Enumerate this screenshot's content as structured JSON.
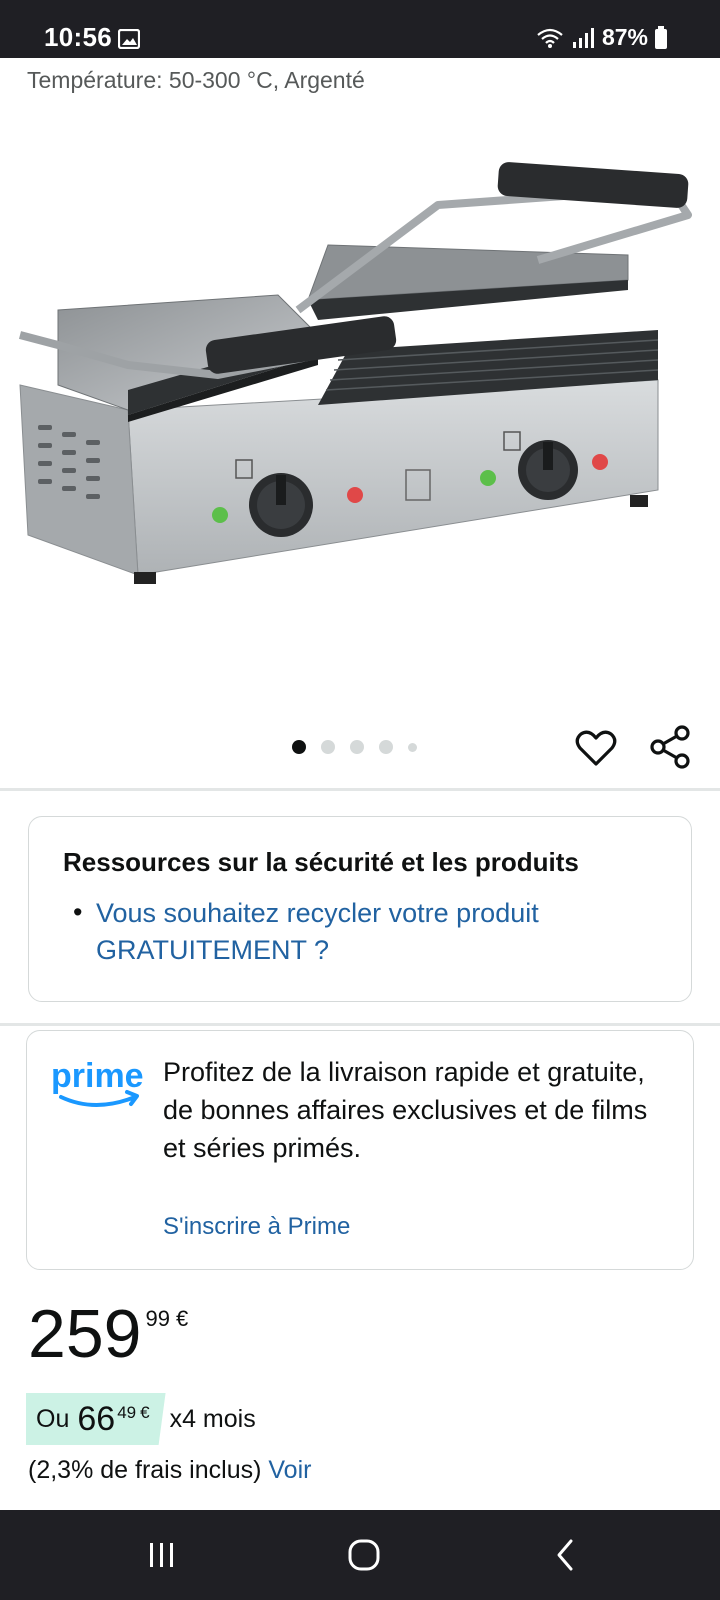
{
  "status_bar": {
    "time": "10:56",
    "battery": "87%",
    "icons": [
      "image-icon",
      "wifi-icon",
      "signal-icon",
      "battery-icon"
    ]
  },
  "product": {
    "subtitle": "Température: 50-300 °C, Argenté",
    "image_alt": "Contact grill"
  },
  "carousel": {
    "total": 5,
    "active": 1
  },
  "safety": {
    "title": "Ressources sur la sécurité et les produits",
    "bullet": "•",
    "link": "Vous souhaitez recycler votre produit GRATUITEMENT ?"
  },
  "prime": {
    "logo_text": "prime",
    "description": "Profitez de la livraison rapide et gratuite, de bonnes affaires exclusives et de films et séries primés.",
    "signup_link": "S'inscrire à Prime"
  },
  "price": {
    "whole": "259",
    "fraction": "99",
    "currency": "€"
  },
  "installment": {
    "prefix": "Ou",
    "whole": "66",
    "fraction": "49",
    "currency": "€",
    "suffix": "x4 mois",
    "fees": "(2,3% de frais inclus)",
    "fees_link": "Voir"
  },
  "colors": {
    "link": "#2162a1",
    "prime_blue": "#1a98ff",
    "installment_bg": "#ccf2e5",
    "system_bar": "#1f1f24"
  }
}
